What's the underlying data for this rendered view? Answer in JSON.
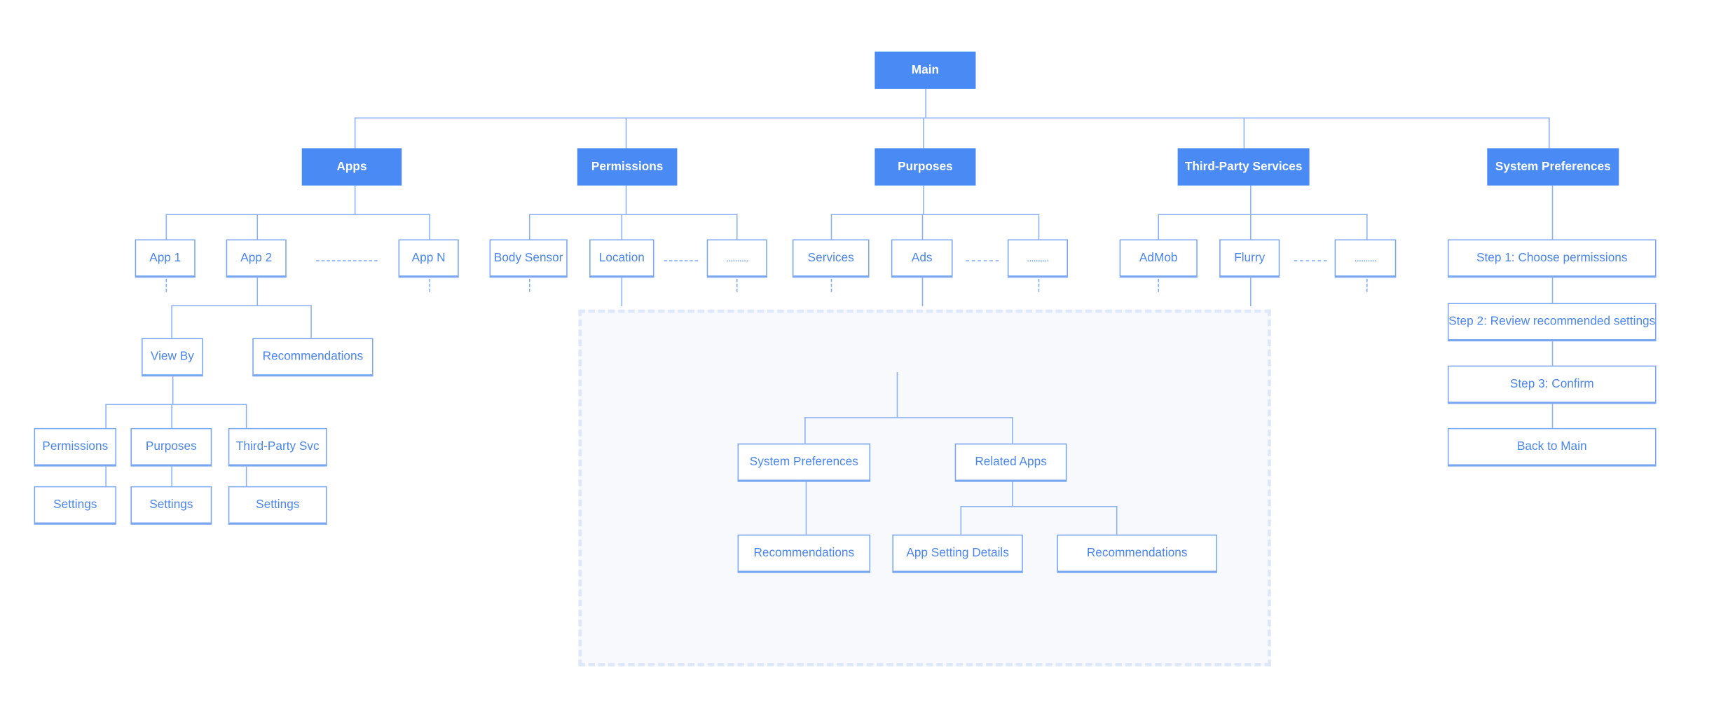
{
  "root": "Main",
  "categories": {
    "apps": "Apps",
    "permissions": "Permissions",
    "purposes": "Purposes",
    "third_party": "Third-Party Services",
    "system_prefs": "System Preferences"
  },
  "apps": {
    "items": [
      "App 1",
      "App 2",
      "App N"
    ],
    "app2_children": [
      "View By",
      "Recommendations"
    ],
    "view_by_children": [
      "Permissions",
      "Purposes",
      "Third-Party Svc"
    ],
    "settings": "Settings"
  },
  "permissions": {
    "items": [
      "Body Sensor",
      "Location",
      ".........."
    ]
  },
  "purposes": {
    "items": [
      "Services",
      "Ads",
      ".........."
    ]
  },
  "third_party": {
    "items": [
      "AdMob",
      "Flurry",
      ".........."
    ]
  },
  "system_prefs": {
    "steps": [
      "Step 1: Choose permissions",
      "Step 2: Review recommended settings",
      "Step 3: Confirm",
      "Back to Main"
    ]
  },
  "shared_detail": {
    "children": [
      "System Preferences",
      "Related Apps"
    ],
    "system_prefs_child": "Recommendations",
    "related_apps_children": [
      "App Setting Details",
      "Recommendations"
    ]
  },
  "colors": {
    "accent": "#4a8af4",
    "line": "#8ab1f2",
    "zone_fill": "#f7f9fd",
    "zone_border": "#dde8fa"
  }
}
